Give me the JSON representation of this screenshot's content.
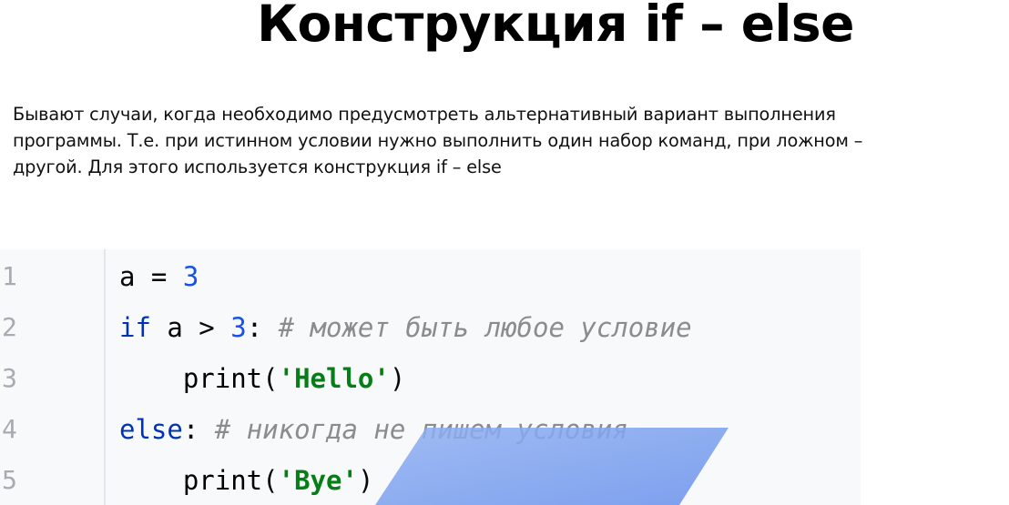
{
  "title": "Конструкция if – else",
  "paragraph": {
    "line1": "Бывают случаи, когда необходимо предусмотреть альтернативный вариант выполнения",
    "line2": "программы. Т.е. при истинном условии нужно выполнить один набор команд, при ложном –",
    "line3": "другой. Для этого используется конструкция if – else"
  },
  "code": {
    "line_numbers": [
      "1",
      "2",
      "3",
      "4",
      "5"
    ],
    "lines": [
      {
        "var": "a",
        "op": " = ",
        "num": "3"
      },
      {
        "kw": "if",
        "rest": " a > ",
        "num": "3",
        "colon": ":",
        "comment": " # может быть любое условие"
      },
      {
        "indent": "    ",
        "fn": "print",
        "open": "(",
        "str": "'Hello'",
        "close": ")"
      },
      {
        "kw": "else",
        "colon": ":",
        "comment": " # никогда не пишем условия"
      },
      {
        "indent": "    ",
        "fn": "print",
        "open": "(",
        "str": "'Bye'",
        "close": ")"
      }
    ]
  }
}
